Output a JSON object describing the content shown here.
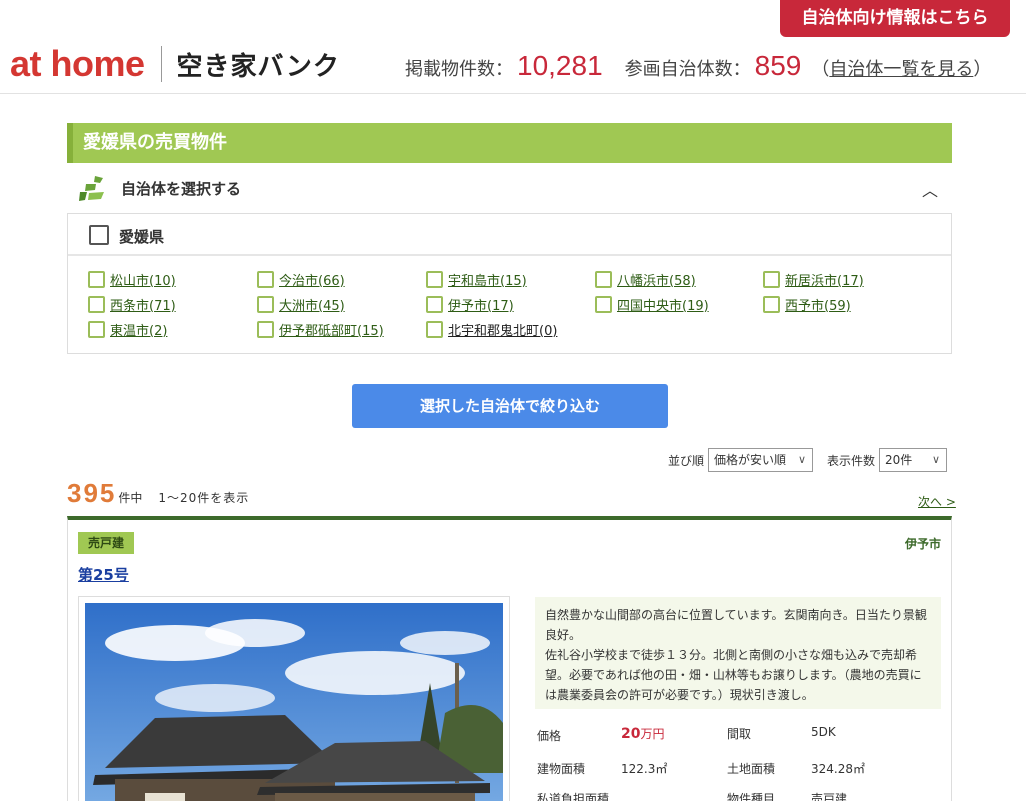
{
  "header": {
    "muni_button": "自治体向け情報はこちら",
    "logo_main": "at home",
    "logo_sub": "空き家バンク",
    "listings_label": "掲載物件数：",
    "listings_count": "10,281",
    "munis_label": "参画自治体数：",
    "munis_count": "859",
    "paren_open": "（",
    "munis_link": "自治体一覧を見る",
    "paren_close": "）"
  },
  "section": {
    "title": "愛媛県の売買物件",
    "select_label": "自治体を選択する",
    "prefecture": "愛媛県"
  },
  "cities": [
    {
      "label": "松山市(10)"
    },
    {
      "label": "今治市(66)"
    },
    {
      "label": "宇和島市(15)"
    },
    {
      "label": "八幡浜市(58)"
    },
    {
      "label": "新居浜市(17)"
    },
    {
      "label": "西条市(71)"
    },
    {
      "label": "大洲市(45)"
    },
    {
      "label": "伊予市(17)"
    },
    {
      "label": "四国中央市(19)"
    },
    {
      "label": "西予市(59)"
    },
    {
      "label": "東温市(2)"
    },
    {
      "label": "伊予郡砥部町(15)"
    },
    {
      "label": "北宇和郡鬼北町(0)"
    }
  ],
  "filter_button": "選択した自治体で絞り込む",
  "sort": {
    "label": "並び順",
    "value": "価格が安い順",
    "per_page_label": "表示件数",
    "per_page_value": "20件"
  },
  "results": {
    "count": "395",
    "unit": "件中",
    "range": "1〜20件を表示",
    "next": "次へ >"
  },
  "listing": {
    "badge": "売戸建",
    "city": "伊予市",
    "title": "第25号",
    "description": "自然豊かな山間部の高台に位置しています。玄関南向き。日当たり景観良好。\n佐礼谷小学校まで徒歩１３分。北側と南側の小さな畑も込みで売却希望。必要であれば他の田・畑・山林等もお譲りします。（農地の売買には農業委員会の許可が必要です。）現状引き渡し。",
    "price_label": "価格",
    "price_value": "20",
    "price_unit": "万円",
    "layout_label": "間取",
    "layout_value": "5DK",
    "building_area_label": "建物面積",
    "building_area_value": "122.3㎡",
    "land_area_label": "土地面積",
    "land_area_value": "324.28㎡",
    "road_area_label": "私道負担面積",
    "type_label": "物件種目",
    "type_value": "売戸建"
  }
}
